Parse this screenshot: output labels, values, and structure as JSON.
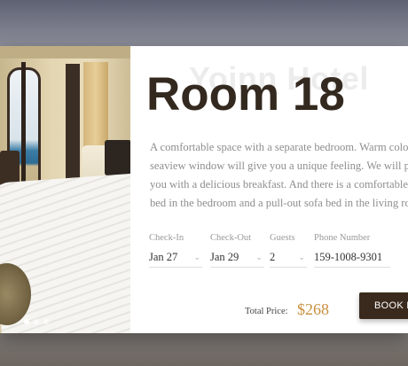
{
  "hotel": {
    "watermark_name": "Yoinn Hotel"
  },
  "room": {
    "title": "Room 18",
    "description_lines": [
      "A comfortable space with a separate bedroom. Warm colors and",
      "seaview window will give you a unique feeling. We will provide",
      "you with a delicious breakfast. And there is a comfortable double",
      "bed in the bedroom and a pull-out sofa bed in the living room."
    ]
  },
  "booking": {
    "checkin": {
      "label": "Check-In",
      "value": "Jan 27",
      "icon": "chevron-down-icon"
    },
    "checkout": {
      "label": "Check-Out",
      "value": "Jan 29",
      "icon": "chevron-down-icon"
    },
    "guests": {
      "label": "Guests",
      "value": "2",
      "icon": "chevron-down-icon"
    },
    "phone": {
      "label": "Phone Number",
      "value": "159-1008-9301"
    },
    "total_label": "Total Price:",
    "total_price": "$268",
    "book_button": "BOOK NOW"
  },
  "carousel": {
    "slide_count": 3,
    "active_index": 0
  },
  "colors": {
    "title": "#33291f",
    "price": "#c9903f",
    "button_bg": "#3a2a1d"
  }
}
